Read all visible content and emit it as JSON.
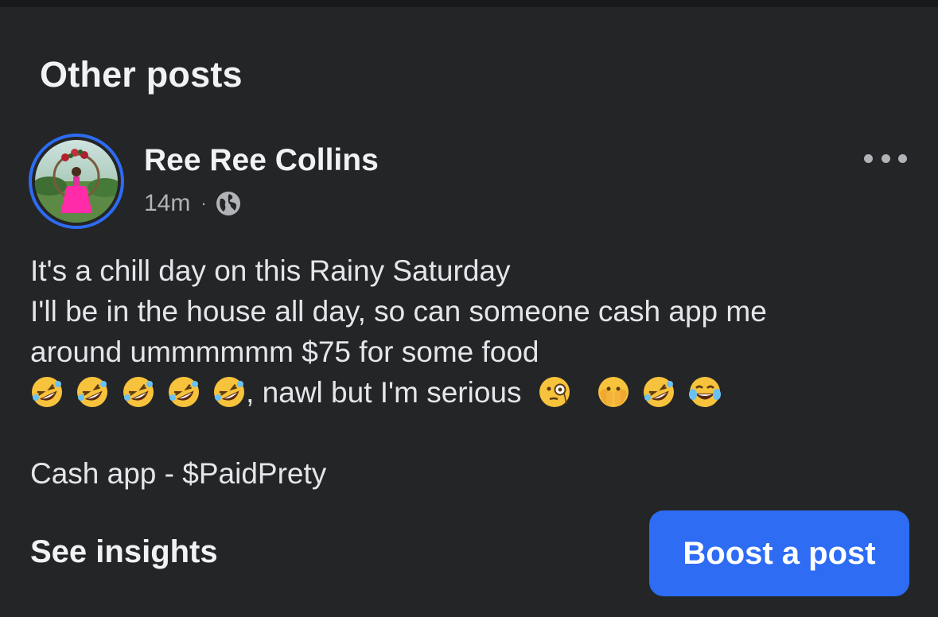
{
  "section": {
    "title": "Other posts"
  },
  "post": {
    "author": "Ree Ree Collins",
    "time": "14m",
    "separator": "·",
    "audience_icon": "globe-icon",
    "menu_icon": "more-options-icon",
    "lines": [
      "It's a chill day on this Rainy Saturday",
      "I'll be in the house all day, so can someone cash app me",
      "around ummmmmm $75 for some food"
    ],
    "emoji_line_text_1": ", nawl but I'm serious ",
    "emoji_line_emojis_before": [
      "rolling-on-floor-laughing",
      "rolling-on-floor-laughing",
      "rolling-on-floor-laughing",
      "rolling-on-floor-laughing",
      "rolling-on-floor-laughing"
    ],
    "emoji_line_emojis_after": [
      "face-with-monocle",
      "face-with-peeking-eye",
      "rolling-on-floor-laughing",
      "face-with-tears-of-joy"
    ],
    "cashapp_line": "Cash app - $PaidPrety"
  },
  "actions": {
    "insights_label": "See insights",
    "boost_label": "Boost a post"
  },
  "colors": {
    "background": "#242526",
    "accent": "#2d6cf3",
    "text_primary": "#f0f2f5",
    "text_secondary": "#b0b3b8"
  }
}
